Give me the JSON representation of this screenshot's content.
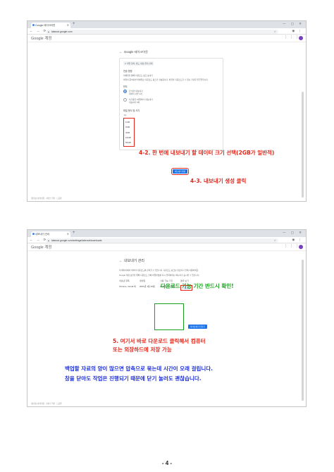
{
  "screenshot1": {
    "tab_title": "Google 테이크아웃",
    "url": "takeout.google.com",
    "brand": "Google 계정",
    "page_title": "Google 테이크아웃",
    "step_label": "2. 파일 형식, 빈도, 대상 폴더 선택",
    "delivery_title": "전송 방법",
    "delivery_value": "이메일을 통해 다운로드 링크 보내기",
    "delivery_desc": "파일이 준비되면 이메일로 다운로드 링크가 전송됩니다. 파일을 다운로드할 수 있는 기간은 일주일입니다.",
    "frequency_title": "빈도",
    "frequency_once": "한 번만 내보내기",
    "frequency_once_desc": "데이터 사본 1개",
    "frequency_repeat": "1년 동안 2개월마다 내보내기",
    "frequency_repeat_desc": "내보내기 6회",
    "filetype_title": "파일 형식 및 크기",
    "filetype_value": ".zip",
    "sizes": [
      "1GB",
      "2GB",
      "4GB",
      "10GB",
      "50GB"
    ],
    "create_button": "내보내기 생성",
    "footer": "개인정보처리방침 · 서비스 약관 · 도움말",
    "annot_size": "4-2. 한 번에 내보내기 할 데이터 크기 선택(2GB가 일반적)",
    "annot_create": "4-3. 내보내기 생성 클릭"
  },
  "screenshot2": {
    "tab_title": "내보내기 관리",
    "url": "takeout.google.com/settings/takeout/downloads",
    "brand": "Google 계정",
    "page_title": "내보내기 관리",
    "desc": "이 페이지에서 데이터 다운로드를 관리할 수 있습니다. 다운로드 링크는 만료되기 전에 사용하세요.",
    "notice": "Google 계정 보안을 위해 다운로드 전에 비밀번호를 다시 입력하라는 메시지가 표시될 수 있습니다.",
    "table_headers": [
      "내보낸 항목",
      "생성일",
      "사용 가능 기간",
      "결과 보기"
    ],
    "table_row": [
      "Chrome, Gmail 외",
      "2021년 1월 19일",
      "2021년 1월 26일",
      "다운로드"
    ],
    "create_new": "새 내보내기 만들기",
    "footer": "개인정보처리방침 · 서비스 약관 · 도움말",
    "annot_period": "다운로드 가능 기간 반드시 확인!",
    "annot_download_1": "5. 여기서 바로 다운로드 클릭해서 컴퓨터",
    "annot_download_2": "또는 외장하드에 저장 가능",
    "annot_note_1": "백업할 자료의 양이 많으면 압축으로 묶는데 시간이 오래 걸립니다.",
    "annot_note_2": "창을 닫아도 작업은 진행되기 때문에 닫기 눌러도 괜찮습니다."
  },
  "page_number": "- 4 -",
  "colors": {
    "annot_red": "#e32619",
    "annot_green": "#17a21b",
    "annot_blue": "#1f31d8",
    "google_blue": "#1a73e8"
  }
}
